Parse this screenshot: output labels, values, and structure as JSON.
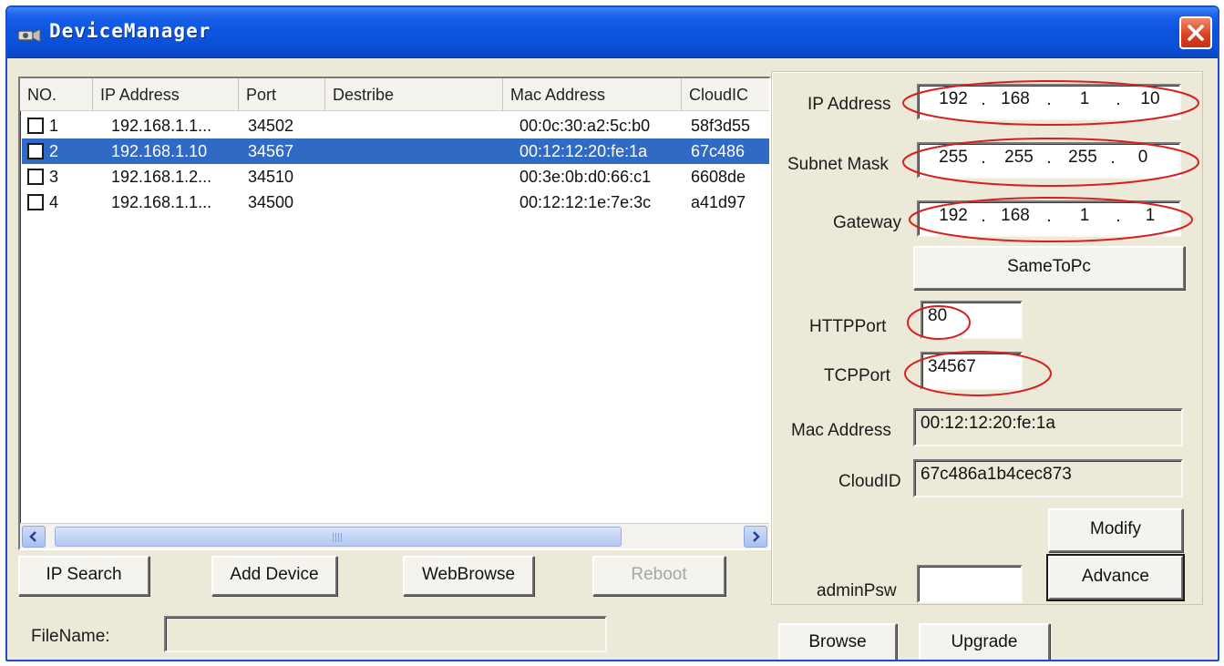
{
  "window": {
    "title": "DeviceManager"
  },
  "device_list": {
    "columns": [
      "NO.",
      "IP Address",
      "Port",
      "Destribe",
      "Mac Address",
      "CloudIC"
    ],
    "rows": [
      {
        "no": "1",
        "ip": "192.168.1.1...",
        "port": "34502",
        "describe": "",
        "mac": "00:0c:30:a2:5c:b0",
        "cloud": "58f3d55"
      },
      {
        "no": "2",
        "ip": "192.168.1.10",
        "port": "34567",
        "describe": "",
        "mac": "00:12:12:20:fe:1a",
        "cloud": "67c486"
      },
      {
        "no": "3",
        "ip": "192.168.1.2...",
        "port": "34510",
        "describe": "",
        "mac": "00:3e:0b:d0:66:c1",
        "cloud": "6608de"
      },
      {
        "no": "4",
        "ip": "192.168.1.1...",
        "port": "34500",
        "describe": "",
        "mac": "00:12:12:1e:7e:3c",
        "cloud": "a41d97"
      }
    ],
    "selected_row": 2
  },
  "buttons": {
    "ip_search": "IP Search",
    "add_device": "Add Device",
    "web_browse": "WebBrowse",
    "reboot": "Reboot",
    "same_to_pc": "SameToPc",
    "modify": "Modify",
    "advance": "Advance",
    "browse": "Browse",
    "upgrade": "Upgrade"
  },
  "file": {
    "label": "FileName:",
    "value": ""
  },
  "settings": {
    "ip_label": "IP Address",
    "ip": [
      "192",
      "168",
      "1",
      "10"
    ],
    "subnet_label": "Subnet Mask",
    "subnet": [
      "255",
      "255",
      "255",
      "0"
    ],
    "gateway_label": "Gateway",
    "gateway": [
      "192",
      "168",
      "1",
      "1"
    ],
    "http_label": "HTTPPort",
    "http_port": "80",
    "tcp_label": "TCPPort",
    "tcp_port": "34567",
    "mac_label": "Mac Address",
    "mac": "00:12:12:20:fe:1a",
    "cloud_label": "CloudID",
    "cloud_id": "67c486a1b4cec873",
    "admin_label": "adminPsw",
    "admin_psw": ""
  },
  "colors": {
    "title_bar": "#0c54df",
    "selection": "#316ac5",
    "annotation": "#d81f1f",
    "window_bg": "#ece9d8"
  }
}
